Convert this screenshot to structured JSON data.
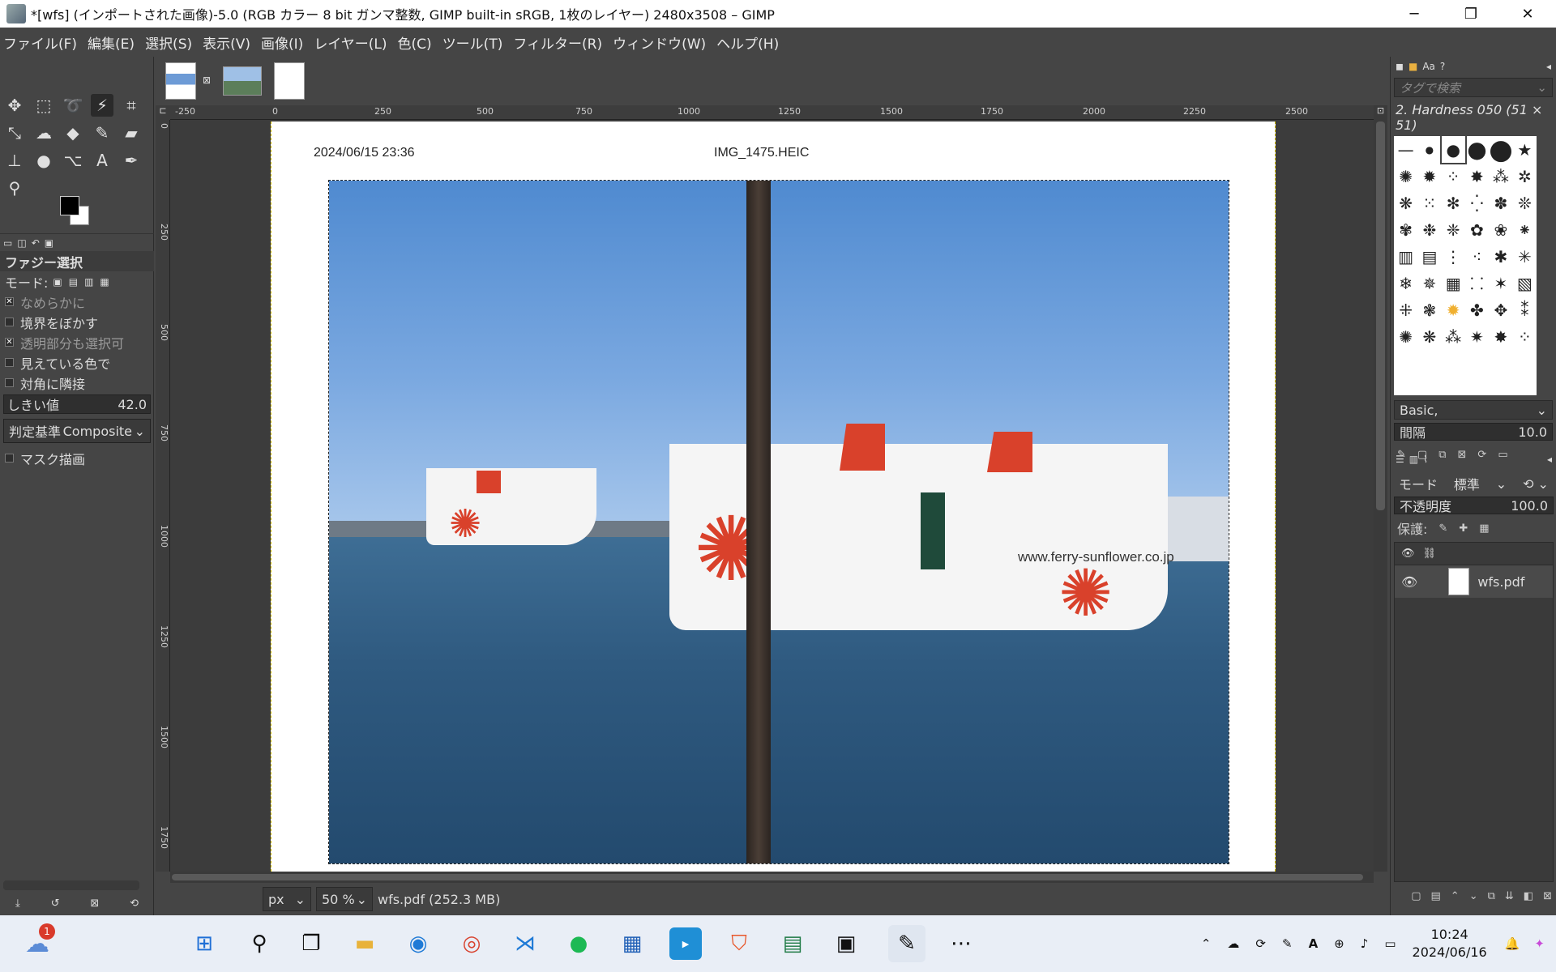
{
  "window": {
    "title": "*[wfs] (インポートされた画像)-5.0 (RGB カラー 8 bit ガンマ整数, GIMP built-in sRGB, 1枚のレイヤー) 2480x3508 – GIMP",
    "min": "─",
    "max": "❐",
    "close": "✕"
  },
  "menu": [
    "ファイル(F)",
    "編集(E)",
    "選択(S)",
    "表示(V)",
    "画像(I)",
    "レイヤー(L)",
    "色(C)",
    "ツール(T)",
    "フィルター(R)",
    "ウィンドウ(W)",
    "ヘルプ(H)"
  ],
  "tool_options": {
    "title": "ファジー選択",
    "mode_label": "モード:",
    "antialias": "なめらかに",
    "feather": "境界をぼかす",
    "transparent": "透明部分も選択可",
    "sample_merged": "見えている色で",
    "diagonal": "対角に隣接",
    "threshold_label": "しきい値",
    "threshold_value": "42.0",
    "criterion_label": "判定基準",
    "criterion_value": "Composite",
    "draw_mask": "マスク描画"
  },
  "ruler_h_ticks": [
    "-250",
    "0",
    "250",
    "500",
    "750",
    "1000",
    "1250",
    "1500",
    "1750",
    "2000",
    "2250",
    "2500"
  ],
  "ruler_v_ticks": [
    "0",
    "250",
    "500",
    "750",
    "1000",
    "1250",
    "1500",
    "1750"
  ],
  "page": {
    "timestamp": "2024/06/15 23:36",
    "filename": "IMG_1475.HEIC",
    "hull_text": "www.ferry-sunflower.co.jp"
  },
  "status": {
    "unit": "px",
    "zoom": "50 %",
    "info": "wfs.pdf (252.3 MB)"
  },
  "brushes": {
    "search_placeholder": "タグで検索",
    "selected_brush": "2. Hardness 050 (51 × 51)",
    "preset": "Basic,",
    "spacing_label": "間隔",
    "spacing_value": "10.0"
  },
  "layers": {
    "mode_label": "モード",
    "mode_value": "標準",
    "opacity_label": "不透明度",
    "opacity_value": "100.0",
    "lock_label": "保護:",
    "layer_name": "wfs.pdf"
  },
  "taskbar": {
    "notification_badge": "1",
    "time": "10:24",
    "date": "2024/06/16"
  }
}
